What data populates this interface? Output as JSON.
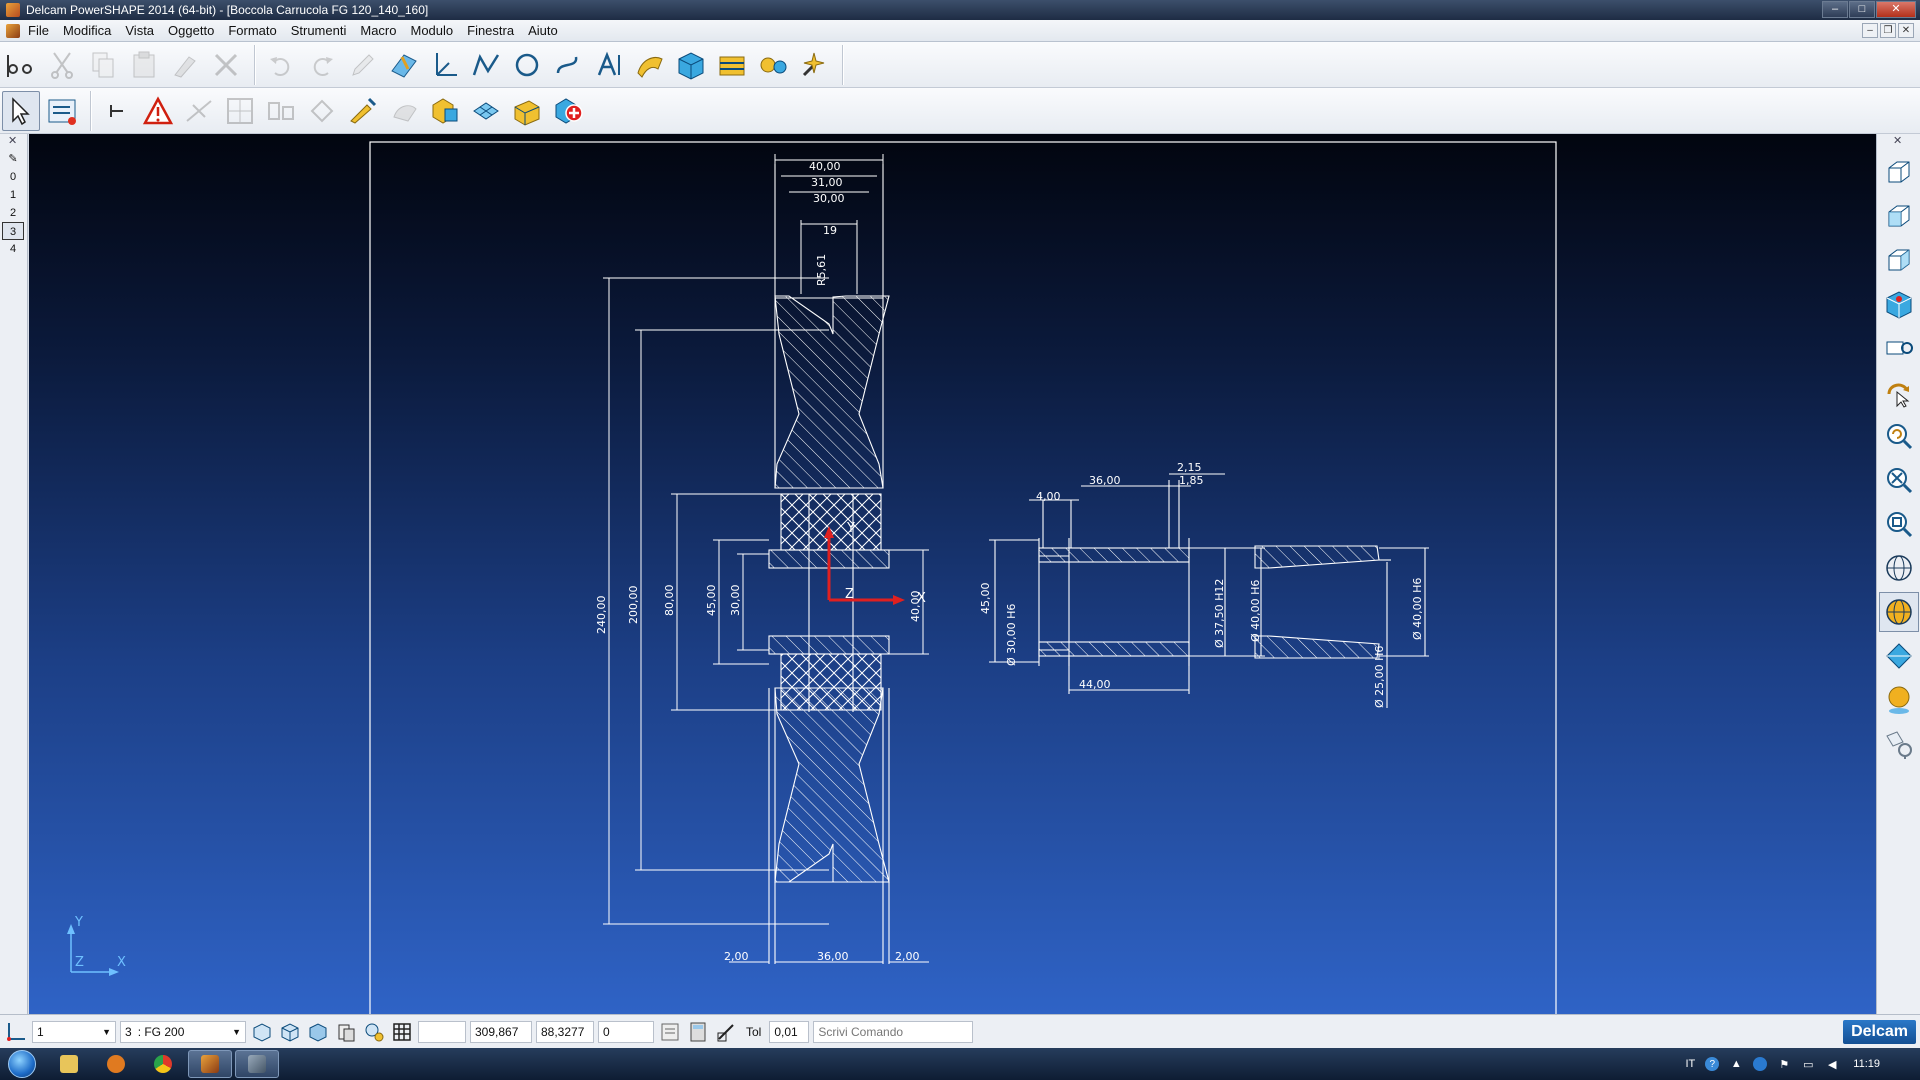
{
  "window": {
    "title": "Delcam PowerSHAPE 2014 (64-bit) - [Boccola Carrucola FG 120_140_160]"
  },
  "menu": {
    "items": [
      "File",
      "Modifica",
      "Vista",
      "Oggetto",
      "Formato",
      "Strumenti",
      "Macro",
      "Modulo",
      "Finestra",
      "Aiuto"
    ]
  },
  "toolbar_main": {
    "icons": [
      "general-edits-icon",
      "cut-icon",
      "copy-icon",
      "paste-icon",
      "format-painter-icon",
      "delete-icon",
      "undo-icon",
      "redo-icon",
      "edit-pencil-icon",
      "workplane-icon",
      "point-icon",
      "line-icon",
      "arc-icon",
      "curve-icon",
      "text-icon",
      "surface-icon",
      "solid-icon",
      "drawing-icon",
      "assembly-icon",
      "electrode-icon"
    ]
  },
  "toolbar_secondary": {
    "icons": [
      "select-arrow-icon",
      "quick-select-icon",
      "anchor-icon",
      "warning-icon",
      "dimension-icon",
      "table-icon",
      "grid-icon",
      "transform-icon",
      "sketch-icon",
      "tool-icon",
      "solid-feature-icon",
      "mesh-icon",
      "render-icon",
      "add-icon"
    ]
  },
  "levels": {
    "items": [
      "0",
      "1",
      "2",
      "3",
      "4"
    ],
    "selected": "3"
  },
  "view_toolbar": {
    "icons": [
      "view-iso1-icon",
      "view-iso2-icon",
      "view-iso3-icon",
      "view-cube-icon",
      "view-camera-icon",
      "rotate-view-icon",
      "zoom-view-icon",
      "zoom-all-icon",
      "zoom-box-icon",
      "wireframe-icon",
      "shaded-icon",
      "planes-icon",
      "material-icon",
      "lights-icon"
    ]
  },
  "drawing": {
    "dimensions": {
      "top_40": "40,00",
      "top_31": "31,00",
      "top_30": "30,00",
      "top_19": "19",
      "radius": "R5,61",
      "v_240": "240,00",
      "v_200": "200,00",
      "v_80": "80,00",
      "v_45": "45,00",
      "v_30": "30,00",
      "v_40": "40,00",
      "b_2a": "2,00",
      "b_36": "36,00",
      "b_2b": "2,00",
      "s_4": "4,00",
      "s_36": "36,00",
      "s_215": "2,15",
      "s_185": "1,85",
      "s_45": "45,00",
      "s_d30": "Ø 30,00 H6",
      "s_d375": "Ø 37,50 H12",
      "s_d40": "Ø 40,00 H6",
      "s_44": "44,00",
      "r_d40": "Ø 40,00 H6",
      "r_d25": "Ø 25,00 H6"
    },
    "axes": {
      "y": "Y",
      "z": "Z",
      "x": "X"
    }
  },
  "status": {
    "workplane": "1",
    "level": "3",
    "level_name": ": FG 200",
    "coord_x": "309,867",
    "coord_y": "88,3277",
    "coord_z": "0",
    "tol_label": "Tol",
    "tol_value": "0,01",
    "command_placeholder": "Scrivi Comando",
    "brand": "Delcam"
  },
  "taskbar": {
    "lang": "IT",
    "clock": "11:19"
  },
  "colors": {
    "viewport_top": "#02050f",
    "viewport_bottom": "#2f63c6",
    "drawing_lines": "#ffffff",
    "axis_y": "#e02020",
    "axis_z": "#e02020"
  }
}
